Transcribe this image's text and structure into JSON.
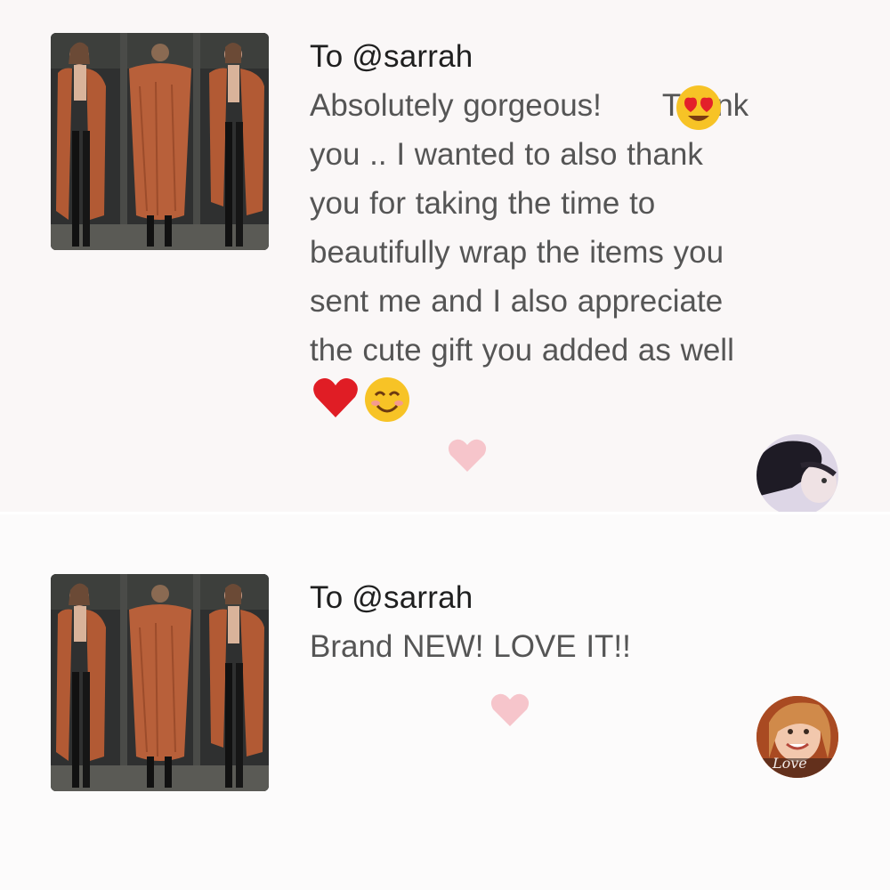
{
  "reviews": [
    {
      "recipient": "To @sarrah",
      "message_lines": [
        "Absolutely gorgeous!",
        "Thank",
        "you .. I wanted to also thank",
        "you for taking the time to",
        "beautifully wrap the items you",
        "sent me and I also appreciate",
        "the cute gift you added as well"
      ],
      "emojis": [
        "heart-eyes-emoji",
        "red-heart-emoji",
        "smiling-face-emoji"
      ],
      "thumbnail": "product-photo-rust-cardigan",
      "reviewer_avatar": "reviewer-avatar-dark-hair"
    },
    {
      "recipient": "To @sarrah",
      "message_lines": [
        "Brand NEW! LOVE IT!!"
      ],
      "thumbnail": "product-photo-rust-cardigan",
      "reviewer_avatar": "reviewer-avatar-smiling",
      "avatar_caption": "Love"
    }
  ],
  "colors": {
    "background": "#faf7f7",
    "like_heart": "#f6c5cb",
    "emoji_red_heart": "#e01d25",
    "emoji_face": "#f7c326",
    "cardigan": "#b25a34"
  }
}
